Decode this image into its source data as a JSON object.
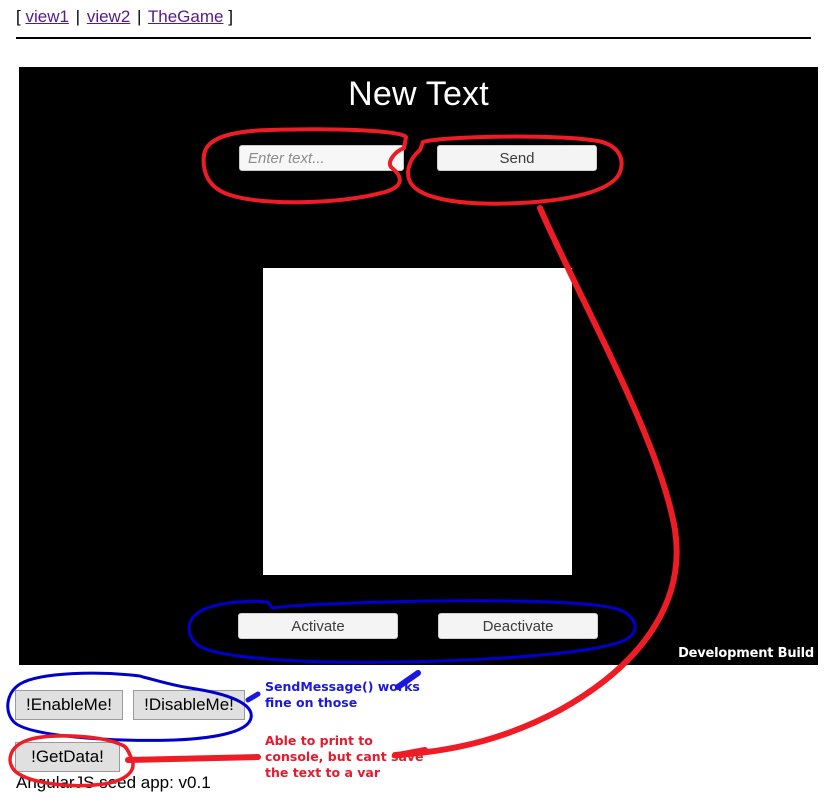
{
  "nav": {
    "open_bracket": "[",
    "close_bracket": "]",
    "separator": "|",
    "links": [
      {
        "label": "view1"
      },
      {
        "label": "view2"
      },
      {
        "label": "TheGame"
      }
    ]
  },
  "game": {
    "title": "New Text",
    "input": {
      "value": "",
      "placeholder": "Enter text..."
    },
    "send_label": "Send",
    "activate_label": "Activate",
    "deactivate_label": "Deactivate",
    "watermark": "Development Build"
  },
  "controls": {
    "enable_label": "!EnableMe!",
    "disable_label": "!DisableMe!",
    "getdata_label": "!GetData!"
  },
  "footer": {
    "text": "AngularJS seed app: v0.1"
  },
  "annotations": {
    "blue_note": "SendMessage() works\nfine on those",
    "red_note": "Able to print to\nconsole, but cant save\nthe text to a var",
    "colors": {
      "red": "#ee1c25",
      "blue": "#1a18e0",
      "link": "#551a8b",
      "canvas_bg": "#000000",
      "panel": "#ffffff"
    }
  }
}
